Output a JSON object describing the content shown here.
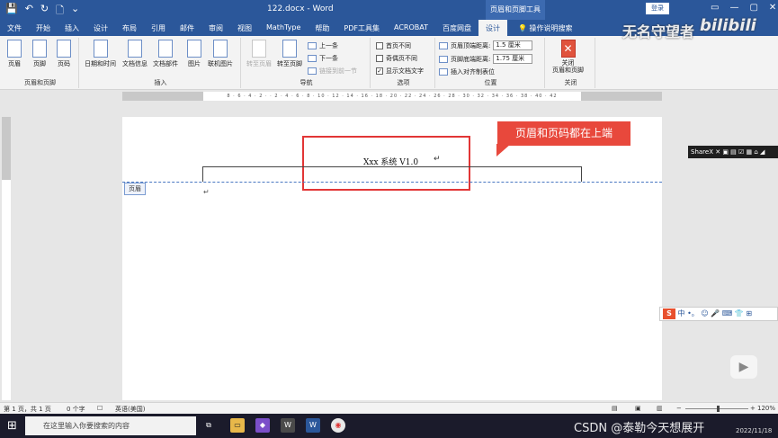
{
  "window": {
    "doc_title": "122.docx  -  Word",
    "context_tools_label": "页眉和页脚工具",
    "login_label": "登录",
    "watermark_name": "无名守望者",
    "watermark_brand": "bilibili",
    "qat_icons": [
      "save-icon",
      "undo-icon",
      "redo-icon",
      "print-preview-icon",
      "customize-icon"
    ]
  },
  "tabs": [
    "文件",
    "开始",
    "插入",
    "设计",
    "布局",
    "引用",
    "邮件",
    "审阅",
    "视图",
    "MathType",
    "帮助",
    "PDF工具集",
    "ACROBAT",
    "百度网盘",
    "设计"
  ],
  "active_tab_index": 14,
  "tell_me": "操作说明搜索",
  "ribbon": {
    "group_header_footer": {
      "label": "页眉和页脚",
      "header": "页眉",
      "footer": "页脚",
      "page_number": "页码"
    },
    "group_insert": {
      "label": "插入",
      "date_time": "日期和时间",
      "doc_info": "文档信息",
      "doc_parts": "文档部件",
      "picture": "图片",
      "online_picture": "联机图片"
    },
    "group_nav": {
      "label": "导航",
      "goto_header": "转至页眉",
      "goto_footer": "转至页脚",
      "prev": "上一条",
      "next": "下一条",
      "link_prev": "链接到前一节"
    },
    "group_options": {
      "label": "选项",
      "diff_first": "首页不同",
      "diff_odd_even": "奇偶页不同",
      "show_doc_text": "显示文档文字"
    },
    "group_position": {
      "label": "位置",
      "header_top": "页眉顶端距离:",
      "header_top_value": "1.5 厘米",
      "footer_bottom": "页脚底端距离:",
      "footer_bottom_value": "1.75 厘米",
      "insert_align_tab": "插入对齐制表位"
    },
    "group_close": {
      "label": "关闭",
      "close_btn": "关闭\n页眉和页脚"
    }
  },
  "ruler_ticks": "8 · 6 · 4 · 2 · · 2 · 4 · 6 · 8 · 10 · 12 · 14 · 16 · 18 · 20 · 22 · 24 · 26 · 28 · 30 · 32 · 34 · 36 · 38 · 40 · 42",
  "document": {
    "header_text": "Xxx 系统 V1.0",
    "header_tag": "页眉",
    "para_mark": "↵",
    "cursor_mark": "↵"
  },
  "callout_text": "页眉和页码都在上端",
  "sharex_label": "ShareX",
  "ime_text": "中 •。 ☺ 🎤 ⌨ 👕 ⊞",
  "status": {
    "page": "第 1 页，共 1 页",
    "words": "0 个字",
    "lang": "英语(美国)",
    "zoom": "120%"
  },
  "taskbar": {
    "search_placeholder": "在这里输入你要搜索的内容",
    "csdn_watermark": "CSDN @泰勒今天想展开",
    "date": "2022/11/18"
  }
}
